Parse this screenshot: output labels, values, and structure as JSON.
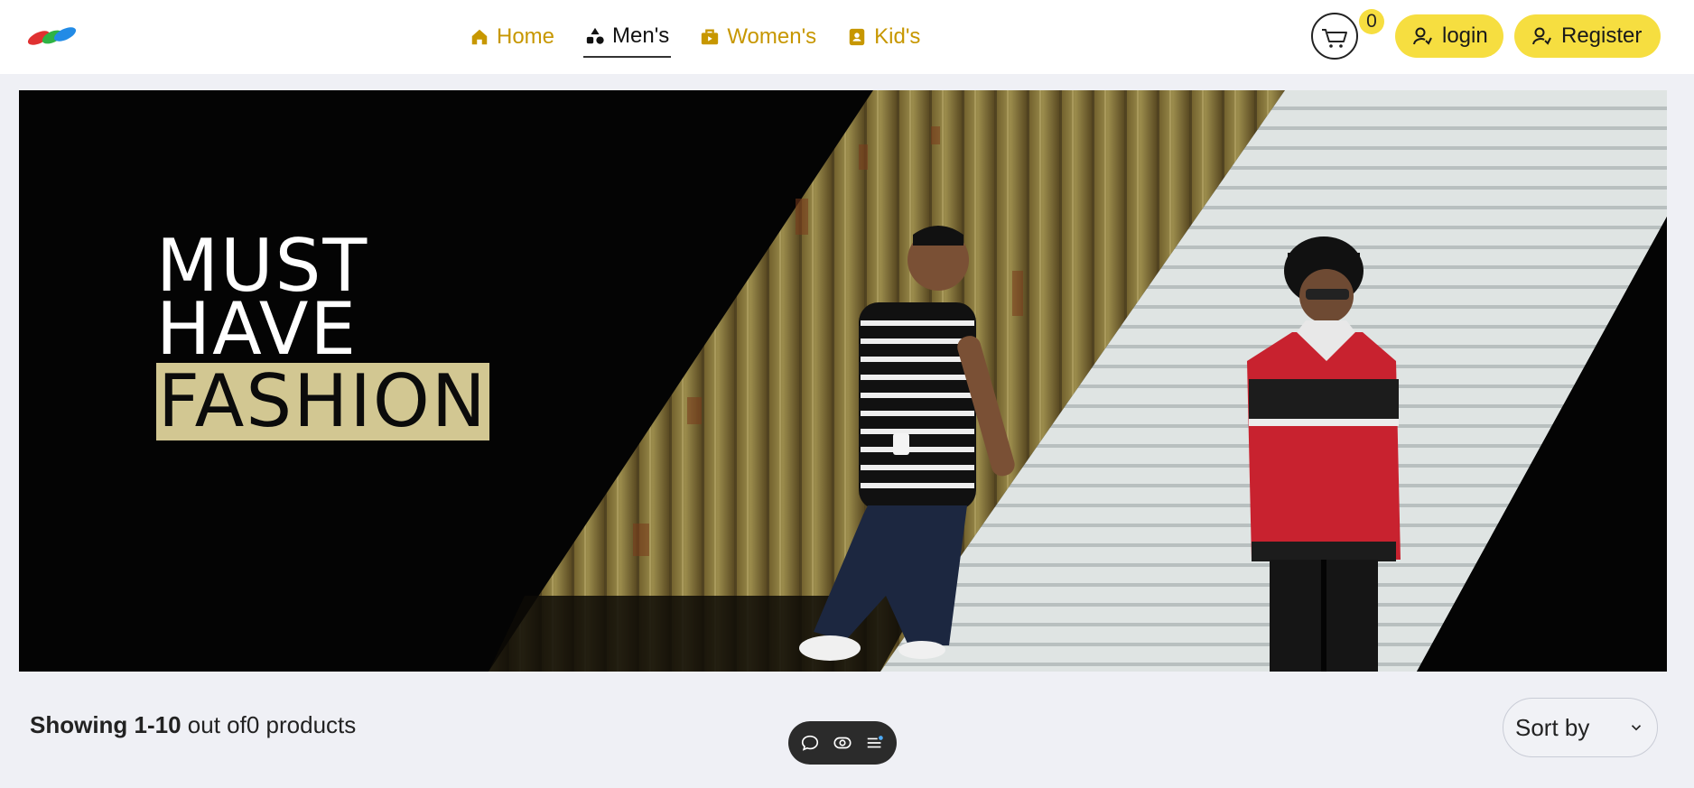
{
  "header": {
    "nav": [
      {
        "label": "Home",
        "icon": "home-icon",
        "active": false
      },
      {
        "label": "Men's",
        "icon": "shapes-icon",
        "active": true
      },
      {
        "label": "Women's",
        "icon": "bag-icon",
        "active": false
      },
      {
        "label": "Kid's",
        "icon": "contact-card-icon",
        "active": false
      }
    ],
    "cart_count": "0",
    "login_label": "login",
    "register_label": "Register"
  },
  "hero": {
    "line1": "MUST",
    "line2": "HAVE",
    "line3": "FASHION"
  },
  "listing": {
    "showing_bold": "Showing 1-10",
    "showing_rest": " out of0 products",
    "sort_label": "Sort by"
  },
  "colors": {
    "accent": "#f6de40",
    "nav_link": "#c79700",
    "highlight": "#d2c792",
    "page_bg": "#eff0f5"
  }
}
